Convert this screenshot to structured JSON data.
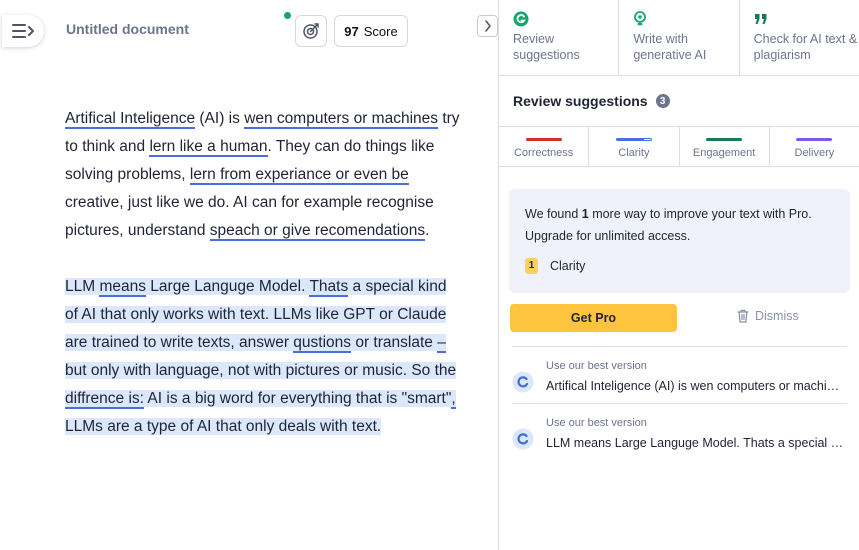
{
  "colors": {
    "correctness": "#d92c2c",
    "clarity": "#4a6ee0",
    "engagement": "#13795b",
    "delivery": "#7c5ce6",
    "pro_button": "#ffc43d",
    "grammarly_green": "#15a66a",
    "highlight": "#dbe8fb"
  },
  "editor": {
    "menu_icon": "hamburger-menu-icon",
    "title": "Untitled document",
    "score_value": "97",
    "score_label": "Score",
    "goals_icon": "target-goals-icon",
    "collapse_icon": "chevron-right-icon",
    "p1": {
      "s1": "Artifical Inteligence",
      "s2": " (AI) is ",
      "s3": "wen computers or machines",
      "s4": " try to think and ",
      "s5": "lern like a human",
      "s6": ". They can do things like solving problems, ",
      "s7": "lern from experiance or even be",
      "s8": " creative, just like we do. AI can for example recognise pictures, understand ",
      "s9": "speach or give recomendations",
      "s10": "."
    },
    "p2": {
      "s1": "LLM ",
      "s2": "means",
      "s3": " Large Languge Model. ",
      "s4": "Thats",
      "s5": " a special kind of AI that only works with text. LLMs like GPT or Claude are trained to write texts, answer ",
      "s6": "qustions",
      "s7": " or translate ",
      "s8": "–",
      "s9": " but only with language, not with pictures or music. So the ",
      "s10": "diffrence is:",
      "s11": " AI is a big word for everything that is \"smart\"",
      "s12": ",",
      "s13": " LLMs are a type of AI that only deals with text."
    }
  },
  "panel": {
    "tabs": [
      {
        "icon": "grammarly-g-icon",
        "label": "Review suggestions"
      },
      {
        "icon": "lightbulb-icon",
        "label": "Write with generative AI"
      },
      {
        "icon": "quote-icon",
        "label": "Check for AI text & plagiarism"
      }
    ],
    "review_title": "Review suggestions",
    "review_count": "3",
    "categories": [
      {
        "label": "Correctness"
      },
      {
        "label": "Clarity"
      },
      {
        "label": "Engagement"
      },
      {
        "label": "Delivery"
      }
    ],
    "pro_card": {
      "text_before": "We found ",
      "count": "1",
      "text_after": " more way to improve your text with Pro. Upgrade for unlimited access.",
      "badge": "1",
      "badge_label": "Clarity"
    },
    "get_pro_label": "Get Pro",
    "dismiss_label": "Dismiss",
    "best_versions": [
      {
        "caption": "Use our best version",
        "text": "Artifical Inteligence (AI) is wen computers or machines try to think and lern like a human."
      },
      {
        "caption": "Use our best version",
        "text": "LLM means Large Languge Model. Thats a special kind of AI that only works with text."
      }
    ]
  }
}
